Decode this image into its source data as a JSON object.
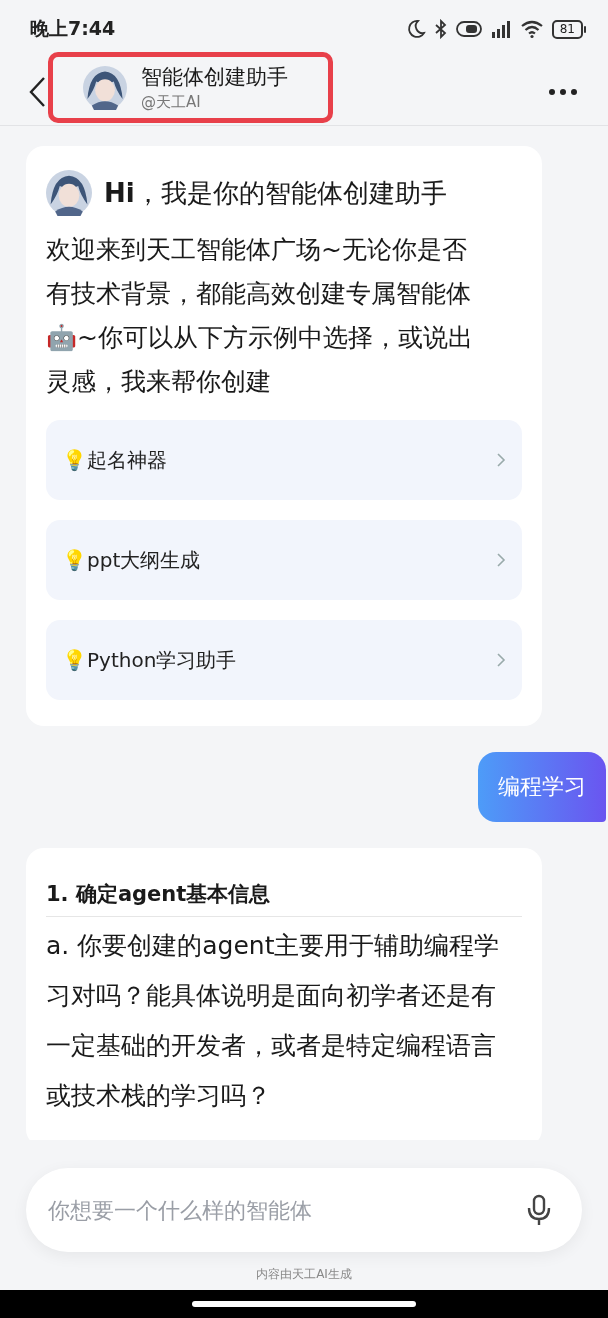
{
  "status_bar": {
    "time": "晚上7:44",
    "battery": "81"
  },
  "header": {
    "title": "智能体创建助手",
    "subtitle": "@天工AI",
    "highlighted": true
  },
  "intro_card": {
    "greeting": "**Hi**，我是你的智能体创建助手",
    "message": "欢迎来到天工智能体广场~无论你是否有技术背景，都能高效创建专属智能体🤖~你可以从下方示例中选择，或说出灵感，我来帮你创建",
    "examples": [
      {
        "label": "💡起名神器"
      },
      {
        "label": "💡ppt大纲生成"
      },
      {
        "label": "💡Python学习助手"
      }
    ]
  },
  "user_message": "编程学习",
  "reply_card": {
    "heading": "1. 确定agent基本信息",
    "text": "a. 你要创建的agent主要用于辅助编程学习对吗？能具体说明是面向初学者还是有一定基础的开发者，或者是特定编程语言或技术栈的学习吗？"
  },
  "input": {
    "placeholder": "你想要一个什么样的智能体"
  },
  "footer": "内容由天工AI生成"
}
